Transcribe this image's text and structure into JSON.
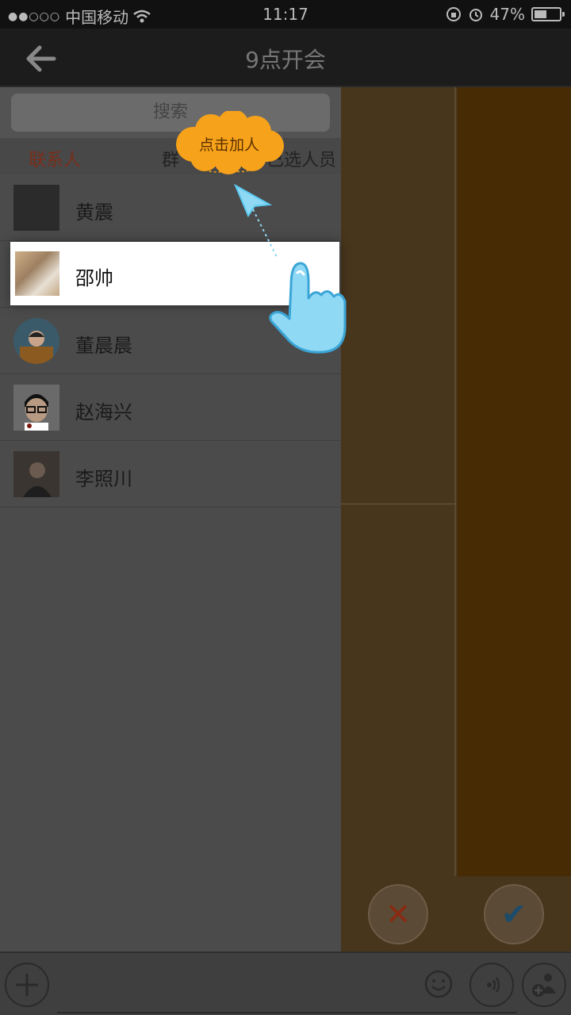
{
  "status_bar": {
    "signal": "●●○○○",
    "carrier": "中国移动",
    "time": "11:17",
    "battery_percent": "47%",
    "battery_level": 0.47
  },
  "nav": {
    "back_icon": "arrow-left-icon",
    "title": "9点开会"
  },
  "search": {
    "placeholder": "搜索"
  },
  "tabs": [
    {
      "label": "联系人",
      "active": true
    },
    {
      "label": "群",
      "active": false
    },
    {
      "label": "已选人员",
      "active": false
    }
  ],
  "contacts": [
    {
      "name": "黄震"
    },
    {
      "name": "邵帅"
    },
    {
      "name": "董晨晨"
    },
    {
      "name": "赵海兴"
    },
    {
      "name": "李照川"
    }
  ],
  "actions": {
    "cancel_symbol": "✕",
    "confirm_symbol": "✔"
  },
  "tooltip": {
    "text": "点击加人"
  },
  "colors": {
    "accent_orange": "#f7a21b",
    "hand_blue": "#5ccaf0"
  }
}
